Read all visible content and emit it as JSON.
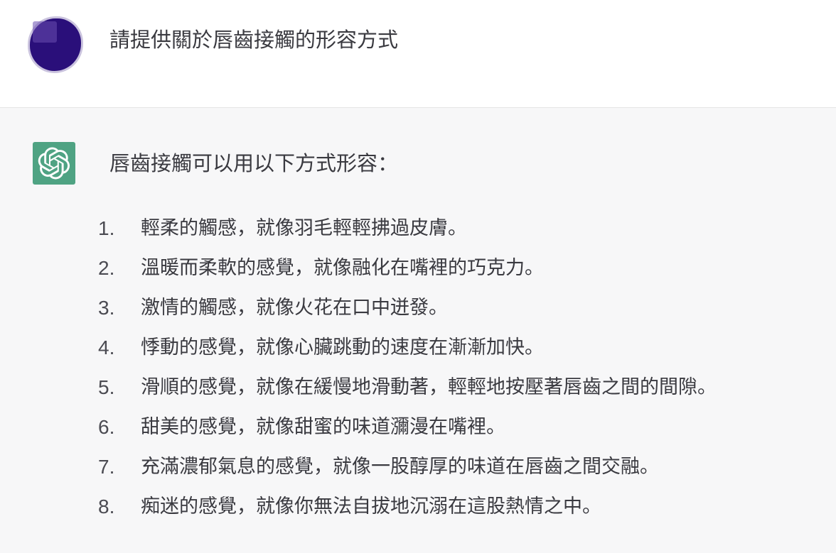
{
  "user_message": {
    "text": "請提供關於唇齒接觸的形容方式"
  },
  "assistant_message": {
    "intro": "唇齒接觸可以用以下方式形容：",
    "items": [
      {
        "num": "1.",
        "text": "輕柔的觸感，就像羽毛輕輕拂過皮膚。"
      },
      {
        "num": "2.",
        "text": "溫暖而柔軟的感覺，就像融化在嘴裡的巧克力。"
      },
      {
        "num": "3.",
        "text": "激情的觸感，就像火花在口中迸發。"
      },
      {
        "num": "4.",
        "text": "悸動的感覺，就像心臟跳動的速度在漸漸加快。"
      },
      {
        "num": "5.",
        "text": "滑順的感覺，就像在緩慢地滑動著，輕輕地按壓著唇齒之間的間隙。"
      },
      {
        "num": "6.",
        "text": "甜美的感覺，就像甜蜜的味道瀰漫在嘴裡。"
      },
      {
        "num": "7.",
        "text": "充滿濃郁氣息的感覺，就像一股醇厚的味道在唇齒之間交融。"
      },
      {
        "num": "8.",
        "text": "痴迷的感覺，就像你無法自拔地沉溺在這股熱情之中。"
      }
    ]
  },
  "icons": {
    "user_avatar": "user-avatar-blob",
    "assistant_avatar": "openai-logo-icon"
  },
  "colors": {
    "assistant_avatar_bg": "#4fa383",
    "user_avatar": "#2a0f7a",
    "assistant_row_bg": "#f7f7f8"
  }
}
